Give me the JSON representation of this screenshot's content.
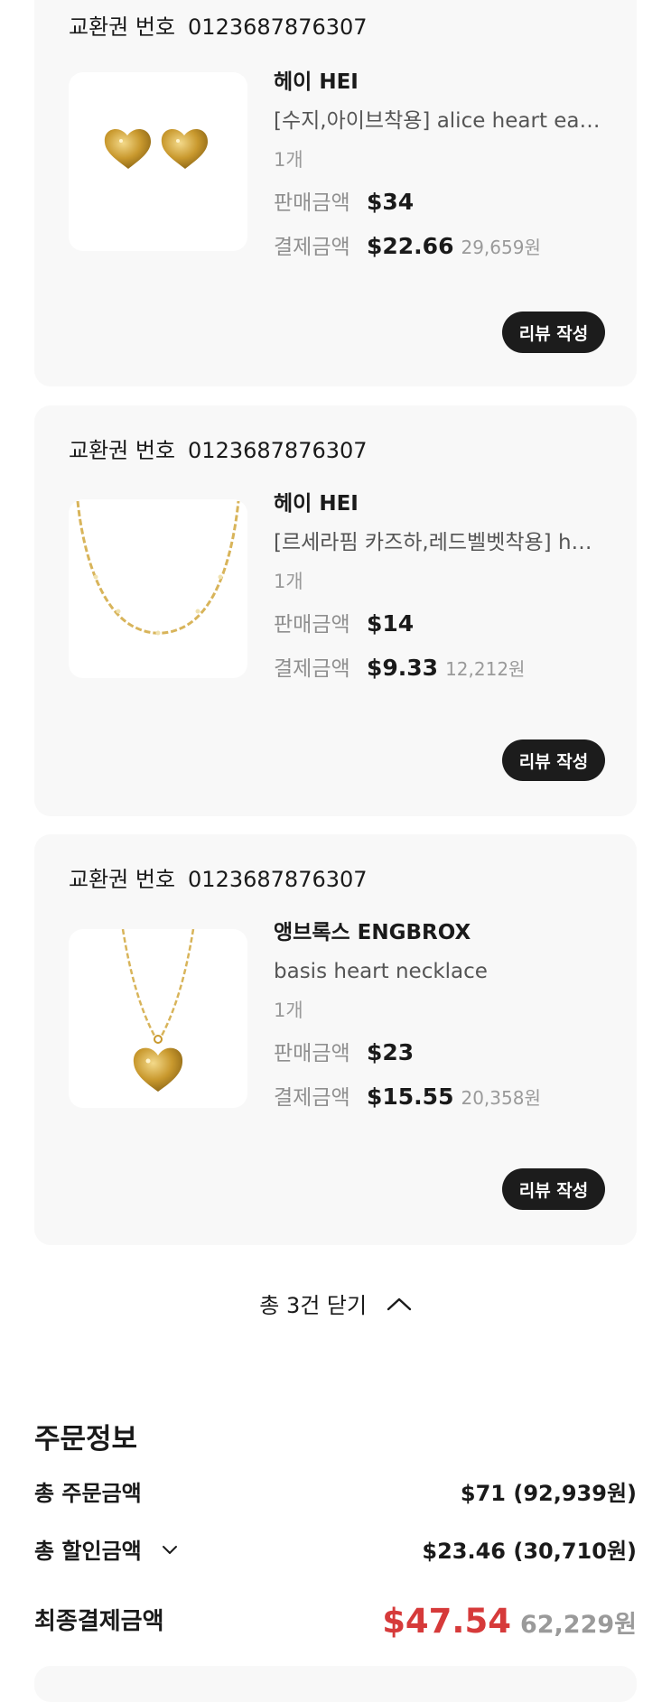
{
  "orders": [
    {
      "voucher_label": "교환권 번호",
      "voucher_number": "0123687876307",
      "image": "gold-heart-earrings",
      "brand": "헤이 HEI",
      "product_name": "[수지,아이브착용] alice heart earri...",
      "quantity": "1개",
      "sale_label": "판매금액",
      "sale_price": "$34",
      "paid_label": "결제금액",
      "paid_price": "$22.66",
      "paid_krw": "29,659원",
      "review_label": "리뷰 작성"
    },
    {
      "voucher_label": "교환권 번호",
      "voucher_number": "0123687876307",
      "image": "gold-chain-necklace",
      "brand": "헤이 HEI",
      "product_name": "[르세라핌 카즈하,레드벨벳착용] hea...",
      "quantity": "1개",
      "sale_label": "판매금액",
      "sale_price": "$14",
      "paid_label": "결제금액",
      "paid_price": "$9.33",
      "paid_krw": "12,212원",
      "review_label": "리뷰 작성"
    },
    {
      "voucher_label": "교환권 번호",
      "voucher_number": "0123687876307",
      "image": "gold-heart-pendant-necklace",
      "brand": "앵브록스 ENGBROX",
      "product_name": "basis heart necklace",
      "quantity": "1개",
      "sale_label": "판매금액",
      "sale_price": "$23",
      "paid_label": "결제금액",
      "paid_price": "$15.55",
      "paid_krw": "20,358원",
      "review_label": "리뷰 작성"
    }
  ],
  "summary_toggle": {
    "label": "총 3건 닫기",
    "icon": "chevron-up-icon"
  },
  "order_info": {
    "title": "주문정보",
    "total_order_label": "총 주문금액",
    "total_order_value": "$71 (92,939원)",
    "total_discount_label": "총 할인금액",
    "total_discount_icon": "chevron-down-icon",
    "total_discount_value": "$23.46 (30,710원)",
    "final_label": "최종결제금액",
    "final_usd": "$47.54",
    "final_krw": "62,229원"
  },
  "colors": {
    "card_background": "#f8f8f8",
    "button_background": "#1c1c1c",
    "final_price_red": "#d63a3a",
    "muted_text": "#9a9a9a"
  }
}
